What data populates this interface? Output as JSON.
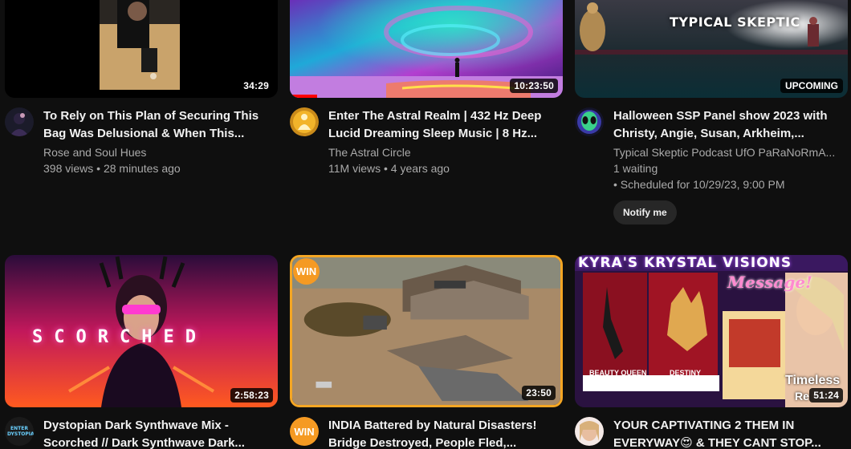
{
  "videos": [
    {
      "title": "To Rely on This Plan of Securing This Bag Was Delusional & When This...",
      "channel": "Rose and Soul Hues",
      "views": "398 views",
      "age": "28 minutes ago",
      "duration": "34:29"
    },
    {
      "title": "Enter The Astral Realm | 432 Hz Deep Lucid Dreaming Sleep Music | 8 Hz...",
      "channel": "The Astral Circle",
      "views": "11M views",
      "age": "4 years ago",
      "duration": "10:23:50",
      "watched_fraction": 0.1
    },
    {
      "title": "Halloween SSP Panel show 2023 with Christy, Angie, Susan, Arkheim,...",
      "channel": "Typical Skeptic Podcast UfO PaRaNoRmA...",
      "waiting": "1 waiting",
      "scheduled": "• Scheduled for 10/29/23, 9:00 PM",
      "badge": "UPCOMING",
      "notify_label": "Notify me",
      "thumb_text": "TYPICAL SKEPTIC"
    },
    {
      "title": "Dystopian Dark Synthwave Mix - Scorched // Dark Synthwave Dark...",
      "duration": "2:58:23",
      "thumb_text": "SCORCHED",
      "avatar_text": "ENTER DYSTOPIA"
    },
    {
      "title": "INDIA Battered by Natural Disasters! Bridge Destroyed, People Fled,...",
      "duration": "23:50",
      "badge_text": "WIN",
      "avatar_text": "WIN"
    },
    {
      "title": "YOUR CAPTIVATING 2 THEM IN EVERYWAY😍 & THEY CANT STOP...",
      "duration": "51:24",
      "thumb_header": "KYRA'S KRYSTAL VISIONS",
      "thumb_message": "Message!",
      "card_left_label": "BEAUTY QUEEN",
      "card_mid_label": "DESTINY",
      "thumb_overlay": "Timeless",
      "thumb_overlay_2": "Re"
    }
  ],
  "colors": {
    "background": "#0f0f0f",
    "primary_text": "#f1f1f1",
    "secondary_text": "#aaaaaa",
    "progress": "#ff0000",
    "chip": "#272727"
  }
}
